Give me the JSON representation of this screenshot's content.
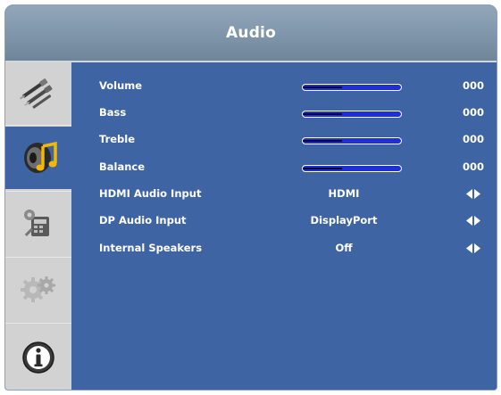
{
  "window": {
    "title": "Audio"
  },
  "sidebar": {
    "items": [
      {
        "name": "input-cables-icon",
        "active": false
      },
      {
        "name": "audio-music-icon",
        "active": true
      },
      {
        "name": "settings-tools-icon",
        "active": false
      },
      {
        "name": "gears-icon",
        "active": false
      },
      {
        "name": "info-icon",
        "active": false
      }
    ]
  },
  "audio": {
    "rows": [
      {
        "label": "Volume",
        "type": "slider",
        "value": "000",
        "level": 0.4
      },
      {
        "label": "Bass",
        "type": "slider",
        "value": "000",
        "level": 0.4
      },
      {
        "label": "Treble",
        "type": "slider",
        "value": "000",
        "level": 0.4
      },
      {
        "label": "Balance",
        "type": "slider",
        "value": "000",
        "level": 0.4
      },
      {
        "label": "HDMI Audio Input",
        "type": "select",
        "value": "HDMI"
      },
      {
        "label": "DP Audio Input",
        "type": "select",
        "value": "DisplayPort"
      },
      {
        "label": "Internal Speakers",
        "type": "select",
        "value": "Off"
      }
    ]
  },
  "colors": {
    "panel": "#3f64a4",
    "title_bar": "#7f95aa",
    "sidebar": "#d2d2d2",
    "slider_track": "#1f2fd8"
  }
}
